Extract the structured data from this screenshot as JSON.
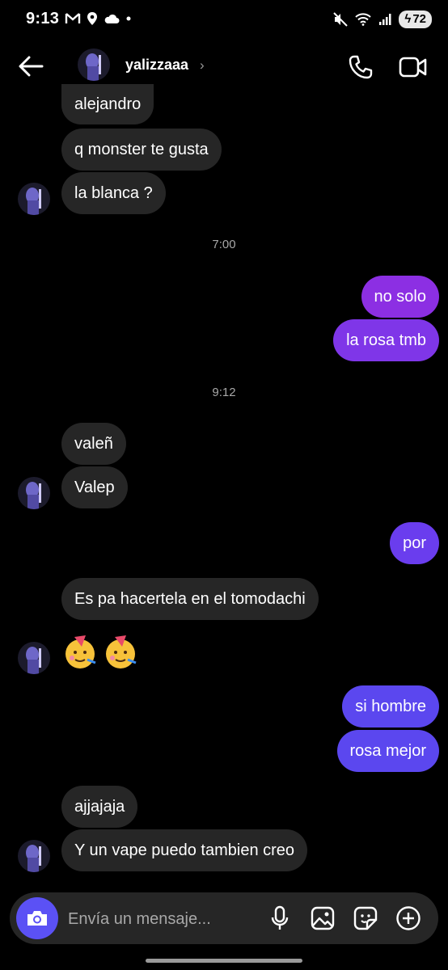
{
  "status_bar": {
    "time": "9:13",
    "battery": "72"
  },
  "header": {
    "username": "yalizzaaa",
    "chevron": "›"
  },
  "messages": [
    {
      "side": "in",
      "text": "alejandro"
    },
    {
      "side": "in",
      "text": "q monster te gusta"
    },
    {
      "side": "in",
      "text": "la blanca ?"
    },
    {
      "side": "out",
      "text": "no solo"
    },
    {
      "side": "out",
      "text": "la rosa tmb"
    },
    {
      "side": "in",
      "text": "valeñ"
    },
    {
      "side": "in",
      "text": "Valep"
    },
    {
      "side": "out",
      "text": "por"
    },
    {
      "side": "in",
      "text": "Es pa hacertela en el tomodachi"
    },
    {
      "side": "in",
      "text": "🥳🥳"
    },
    {
      "side": "out",
      "text": "si hombre"
    },
    {
      "side": "out",
      "text": "rosa mejor"
    },
    {
      "side": "in",
      "text": "ajjajaja"
    },
    {
      "side": "in",
      "text": "Y un vape puedo tambien creo"
    }
  ],
  "timestamps": [
    "7:00",
    "9:12"
  ],
  "composer": {
    "placeholder": "Envía un mensaje..."
  },
  "icons": {
    "back": "arrow-left-icon",
    "call": "phone-icon",
    "video": "video-camera-icon",
    "camera": "camera-icon",
    "mic": "microphone-icon",
    "gallery": "image-icon",
    "sticker": "sticker-icon",
    "add": "plus-circle-icon"
  },
  "colors": {
    "background": "#000000",
    "incoming_bubble": "#262626",
    "outgoing_purple": "#8c2fe3",
    "outgoing_indigo": "#5b47ef",
    "camera_button": "#5b51f5"
  }
}
